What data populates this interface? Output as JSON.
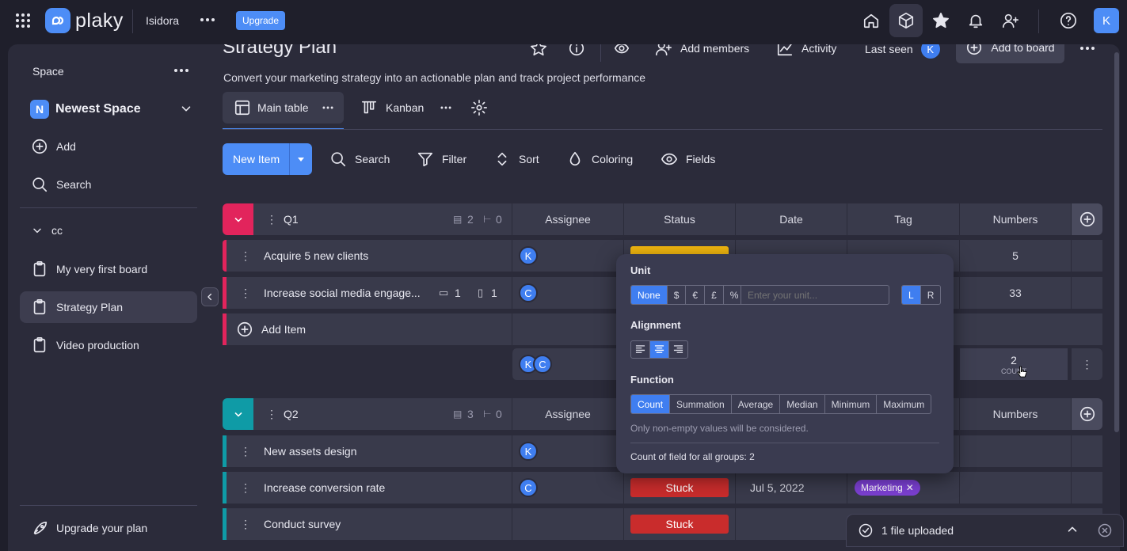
{
  "topbar": {
    "logo": "plaky",
    "workspace": "Isidora",
    "upgrade": "Upgrade",
    "avatar": "K"
  },
  "sidebar": {
    "space_label": "Space",
    "space_name": "Newest Space",
    "space_initial": "N",
    "add": "Add",
    "search": "Search",
    "folder": "cc",
    "boards": [
      {
        "label": "My very first board"
      },
      {
        "label": "Strategy Plan"
      },
      {
        "label": "Video production"
      }
    ],
    "upgrade": "Upgrade your plan"
  },
  "board": {
    "title": "Strategy Plan",
    "description": "Convert your marketing strategy into an actionable plan and track project performance",
    "add_members": "Add members",
    "activity": "Activity",
    "last_seen": "Last seen",
    "last_seen_avatar": "K",
    "add_to_board": "Add to board",
    "views": [
      {
        "label": "Main table"
      },
      {
        "label": "Kanban"
      }
    ]
  },
  "toolbar": {
    "new_item": "New Item",
    "search": "Search",
    "filter": "Filter",
    "sort": "Sort",
    "coloring": "Coloring",
    "fields": "Fields"
  },
  "columns": [
    "Assignee",
    "Status",
    "Date",
    "Tag",
    "Numbers"
  ],
  "groups": [
    {
      "name": "Q1",
      "color": "#e2245c",
      "items_count": "2",
      "sub_count": "0",
      "rows": [
        {
          "name": "Acquire 5 new clients",
          "assignee": "K",
          "number": "5"
        },
        {
          "name": "Increase social media engage...",
          "comments": "1",
          "files": "1",
          "assignee": "C",
          "number": "33"
        }
      ],
      "add_item": "Add Item",
      "summary_avatars": [
        "K",
        "C"
      ],
      "summary_value": "2",
      "summary_label": "COUNT"
    },
    {
      "name": "Q2",
      "color": "#0f9ba6",
      "items_count": "3",
      "sub_count": "0",
      "rows": [
        {
          "name": "New assets design",
          "assignee": "K"
        },
        {
          "name": "Increase conversion rate",
          "assignee": "C",
          "status": "Stuck",
          "date": "Jul 5, 2022",
          "tag": "Marketing"
        },
        {
          "name": "Conduct survey",
          "status": "Stuck"
        }
      ]
    }
  ],
  "popup": {
    "unit_label": "Unit",
    "units": [
      "None",
      "$",
      "€",
      "£",
      "%"
    ],
    "unit_placeholder": "Enter your unit...",
    "pos": [
      "L",
      "R"
    ],
    "alignment_label": "Alignment",
    "function_label": "Function",
    "functions": [
      "Count",
      "Summation",
      "Average",
      "Median",
      "Minimum",
      "Maximum"
    ],
    "note": "Only non-empty values will be considered.",
    "footer": "Count of field for all groups: 2"
  },
  "toast": {
    "text": "1 file uploaded"
  }
}
